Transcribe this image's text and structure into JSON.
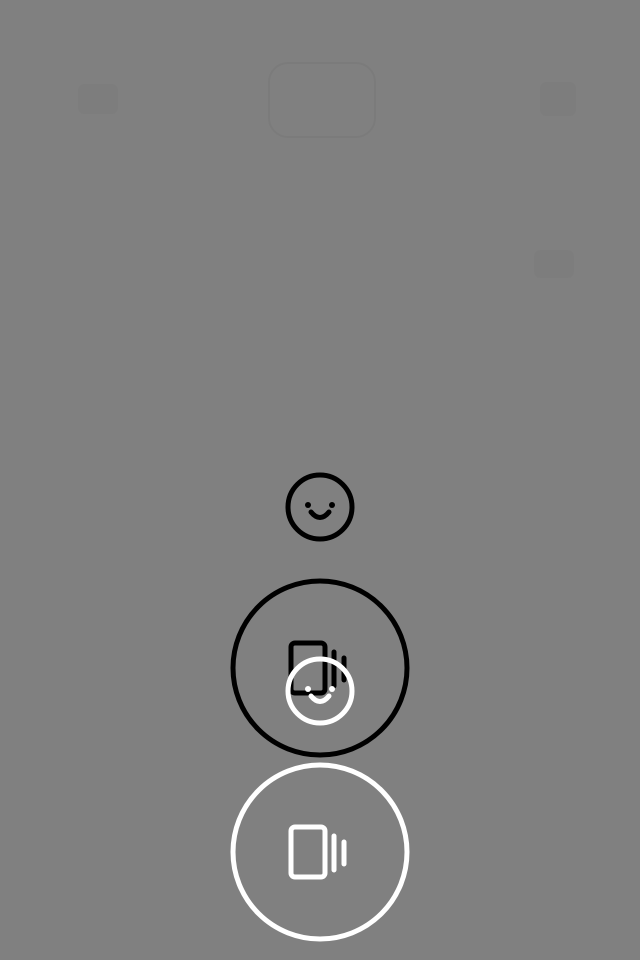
{
  "screen": {
    "background": "#808080",
    "overlay": "dimmed-tutorial-overlay"
  },
  "icons": {
    "smiley_outline_dark": "smiley-face-icon",
    "smiley_outline_light": "smiley-face-icon",
    "vibrate_dark": "phone-vibrate-icon",
    "vibrate_light": "phone-vibrate-icon"
  },
  "colors": {
    "dark_stroke": "#000000",
    "light_stroke": "#ffffff"
  }
}
